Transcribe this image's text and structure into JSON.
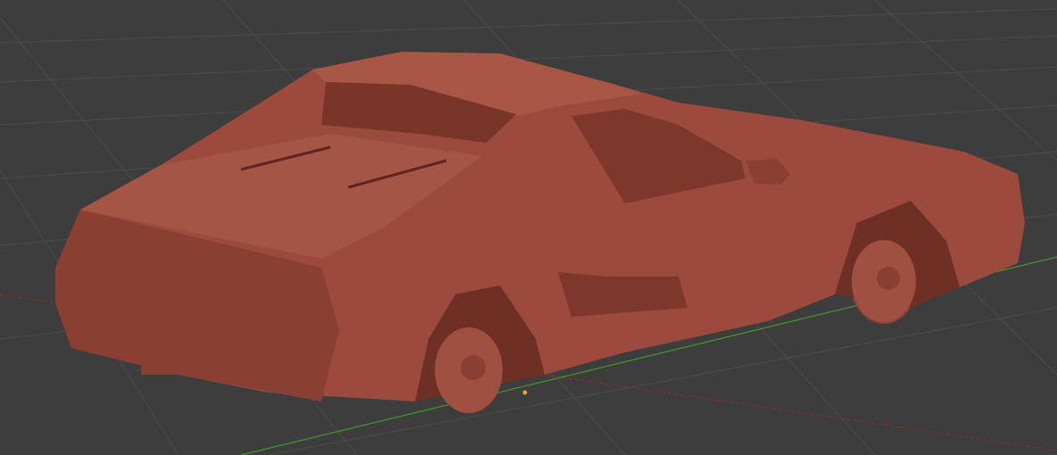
{
  "viewport": {
    "background_color": "#3d3d3d",
    "grid_color": "#4a4a4a",
    "x_axis_color": "#8a2d2d",
    "y_axis_color": "#3f9a2a",
    "model_color": "#9c4a3d",
    "model_shadow_color": "#6e2f25",
    "model_highlight_color": "#b0604f"
  }
}
